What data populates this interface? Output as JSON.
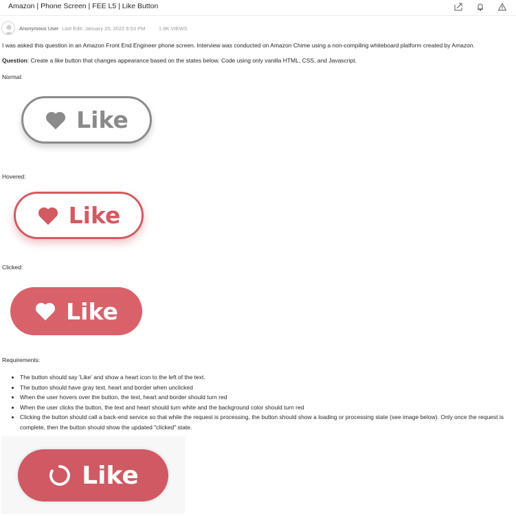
{
  "header": {
    "title": "Amazon | Phone Screen | FEE L5 | Like Button",
    "icons": [
      "share-icon",
      "bell-icon",
      "report-icon"
    ]
  },
  "meta": {
    "author": "Anonymous User",
    "last_edit": "Last Edit: January 25, 2022 6:53 PM",
    "views": "1.8K VIEWS"
  },
  "post": {
    "intro": "I was asked this question in an Amazon Front End Engineer phone screen. Interview was conducted on Amazon Chime using a non-compiling whiteboard platform created by Amazon.",
    "question_label": "Question",
    "question_text": ": Create a like button that changes appearance based on the states below. Code using only vanilla HTML, CSS, and Javascript.",
    "normal_label": "Normal:",
    "hovered_label": "Hovered:",
    "clicked_label": "Clicked:",
    "requirements_label": "Requirements:",
    "requirements": [
      "The button should say 'Like' and show a heart icon to the left of the text.",
      "The button should have gray text, heart and border when unclicked",
      "When the user hovers over the button, the text, heart and border should turn red",
      "When the user clicks the button, the text and heart should turn white and the background color should turn red",
      "Clicking the button should call a back-end service so that while the request is processing, the button should show a loading or processing state (see image below). Only once the request is complete, then the button should show the updated \"clicked\" state."
    ]
  },
  "buttons": {
    "normal_label": "Like",
    "hovered_label": "Like",
    "clicked_label": "Like",
    "loading_label": "Like"
  },
  "colors": {
    "gray": "#8a8a8a",
    "red": "#d35a61",
    "red_fill": "#d9616a",
    "white": "#ffffff"
  }
}
